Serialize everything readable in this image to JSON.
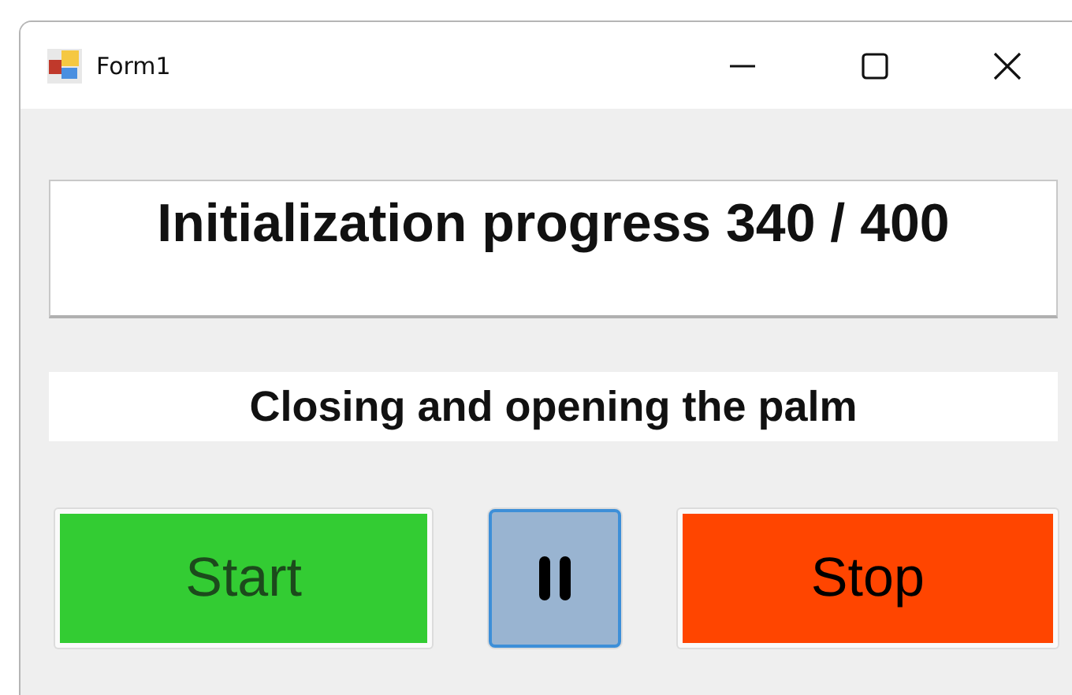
{
  "window": {
    "title": "Form1"
  },
  "progress_box": {
    "value": "Initialization progress 340 / 400"
  },
  "status_label": "Closing and opening the palm",
  "buttons": [
    {
      "kind": "text",
      "label": "Start",
      "color": "#33cc33",
      "disabled": true,
      "focused": false
    },
    {
      "kind": "pause",
      "color": "#99b4d1",
      "disabled": false,
      "focused": true
    },
    {
      "kind": "text",
      "label": "Stop",
      "color": "#ff4500",
      "disabled": false,
      "focused": false
    }
  ]
}
